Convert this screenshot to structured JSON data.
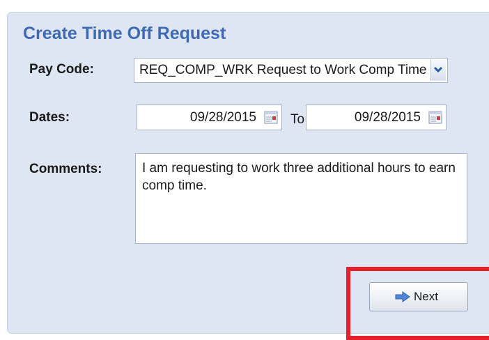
{
  "form": {
    "title": "Create Time Off Request",
    "pay_code": {
      "label": "Pay Code:",
      "selected_value": "REQ_COMP_WRK Request to Work Comp Time"
    },
    "dates": {
      "label": "Dates:",
      "start_date": "09/28/2015",
      "separator": "To",
      "end_date": "09/28/2015"
    },
    "comments": {
      "label": "Comments:",
      "value": "I am requesting to work three additional hours to earn comp time."
    },
    "next_label": "Next"
  },
  "icons": {
    "dropdown": "chevron-down-icon",
    "date_picker": "calendar-icon",
    "next": "arrow-right-icon"
  },
  "colors": {
    "panel_background": "#dfe6f3",
    "title": "#3f6ab3",
    "next_arrow": "#4f86d8",
    "highlight": "#e5202a"
  }
}
